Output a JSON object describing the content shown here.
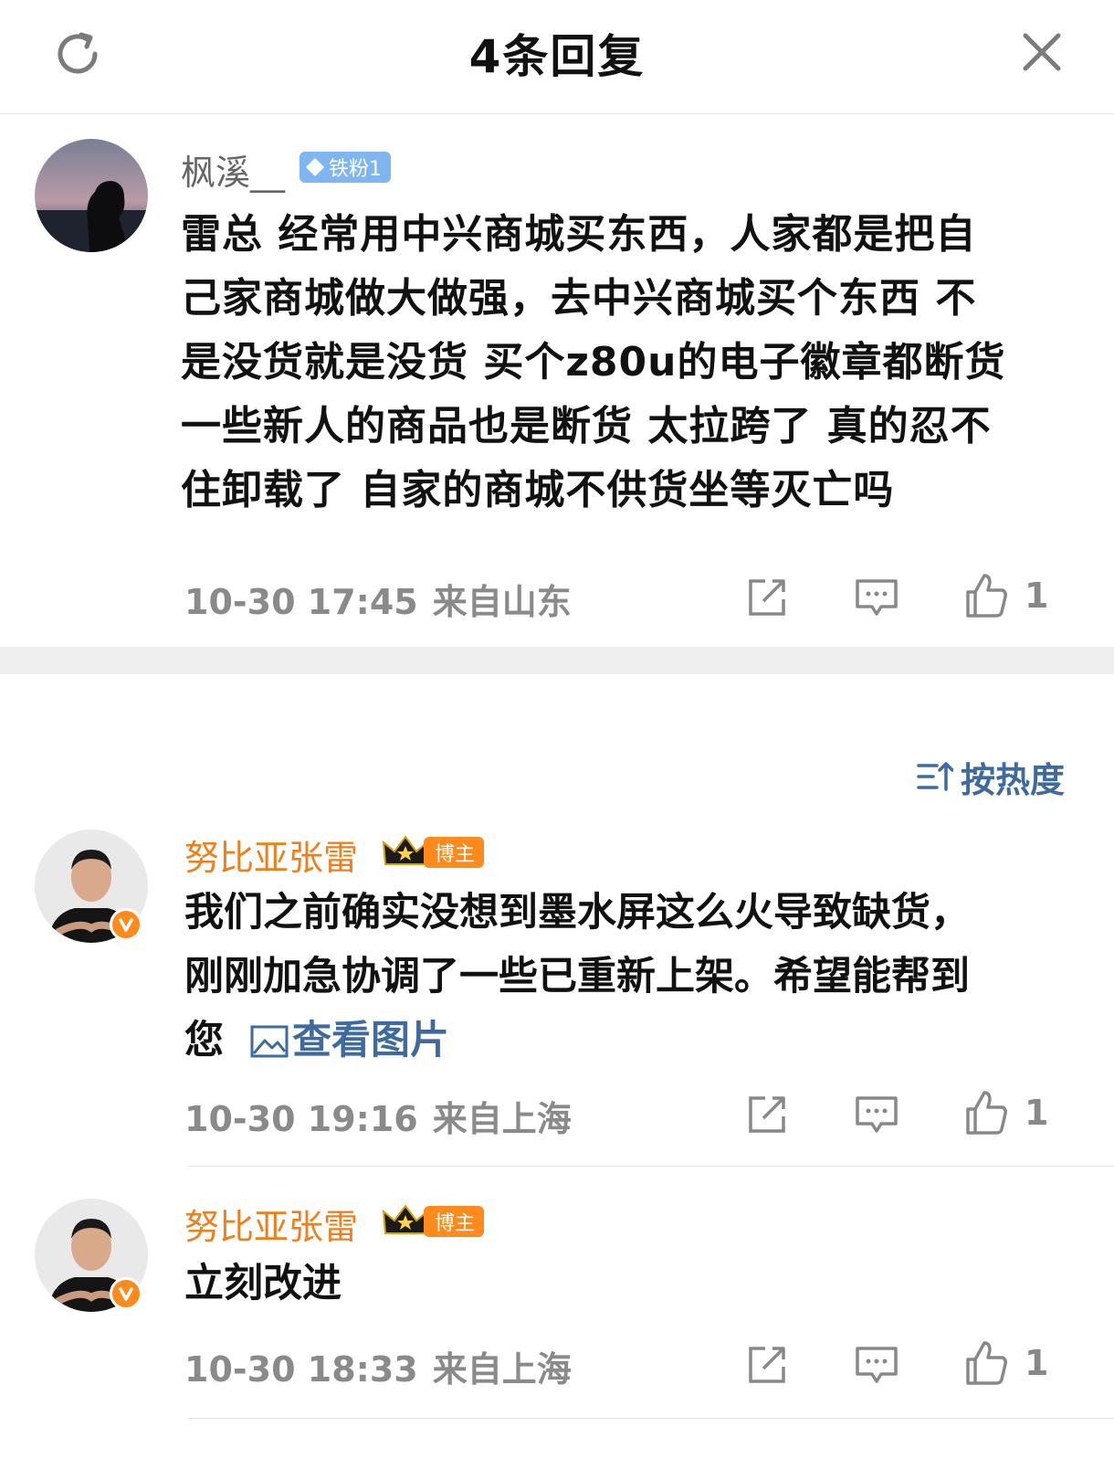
{
  "header": {
    "title": "4条回复",
    "refresh_icon": "refresh-icon",
    "close_icon": "close-icon"
  },
  "root_comment": {
    "username": "枫溪__",
    "badge": "铁粉1",
    "text_lines": [
      "雷总 经常用中兴商城买东西，人家都是把自",
      "己家商城做大做强，去中兴商城买个东西 不",
      "是没货就是没货 买个z80u的电子徽章都断货",
      "一些新人的商品也是断货 太拉跨了 真的忍不",
      "住卸载了 自家的商城不供货坐等灭亡吗"
    ],
    "time": "10-30 17:45",
    "location": "来自山东",
    "likes": "1"
  },
  "sort": {
    "label": "按热度",
    "icon": "sort-icon"
  },
  "replies": [
    {
      "username": "努比亚张雷",
      "badge": "博主",
      "text_lines": [
        "我们之前确实没想到墨水屏这么火导致缺货，",
        "刚刚加急协调了一些已重新上架。希望能帮到"
      ],
      "text_tail": "您",
      "image_link": "查看图片",
      "time": "10-30 19:16",
      "location": "来自上海",
      "likes": "1"
    },
    {
      "username": "努比亚张雷",
      "badge": "博主",
      "text_lines": [
        "立刻改进"
      ],
      "time": "10-30 18:33",
      "location": "来自上海",
      "likes": "1"
    }
  ],
  "colors": {
    "username_gray": "#666666",
    "username_vip": "#f07f1b",
    "link_blue": "#3e6a9e",
    "meta_gray": "#8a8a8a",
    "verified_orange": "#ff8a1c"
  }
}
